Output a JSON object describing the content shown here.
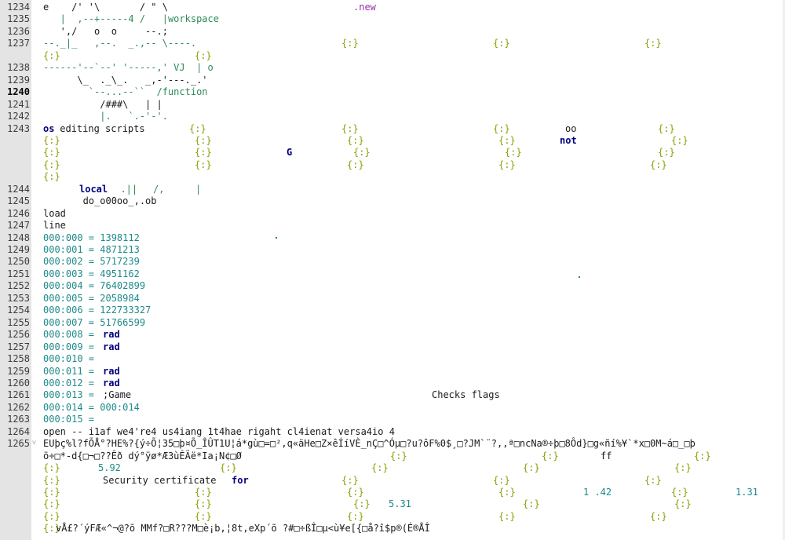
{
  "editor": {
    "current_line": 1240,
    "lines": [
      {
        "n": 1234,
        "rows": [
          [
            [
              0,
              "e    /' '\\       / \" \\",
              "d"
            ],
            [
              395,
              ".new",
              "m"
            ]
          ]
        ]
      },
      {
        "n": 1235,
        "rows": [
          [
            [
              0,
              "   |  ,--+-----4 /   |workspace",
              "g"
            ]
          ]
        ]
      },
      {
        "n": 1236,
        "rows": [
          [
            [
              0,
              "   ',/   o  o     --.;",
              "d"
            ]
          ]
        ]
      },
      {
        "n": 1237,
        "rows": [
          [
            [
              0,
              "--._|_   ,--.  _.,-- \\----.",
              "g"
            ],
            [
              380,
              "{:}",
              "y"
            ],
            [
              573,
              "{:}",
              "y"
            ],
            [
              766,
              "{:}",
              "y"
            ]
          ],
          [
            [
              0,
              "{:}",
              "y"
            ],
            [
              193,
              "{:}",
              "y"
            ]
          ]
        ]
      },
      {
        "n": 1238,
        "rows": [
          [
            [
              0,
              "------'--`--' '-----,' VJ  | o",
              "g"
            ]
          ]
        ]
      },
      {
        "n": 1239,
        "rows": [
          [
            [
              0,
              "      \\_  ._\\_.   _,-'---._.'",
              "d"
            ]
          ]
        ]
      },
      {
        "n": 1240,
        "rows": [
          [
            [
              0,
              "        `--...--``  /function",
              "g"
            ]
          ]
        ]
      },
      {
        "n": 1241,
        "rows": [
          [
            [
              0,
              "          /###\\   | |",
              "d"
            ]
          ]
        ]
      },
      {
        "n": 1242,
        "rows": [
          [
            [
              0,
              "          |.   `.-'-'.",
              "g"
            ]
          ]
        ]
      },
      {
        "n": 1243,
        "rows": [
          [
            [
              0,
              "os",
              "k"
            ],
            [
              14,
              " editing scripts",
              "d"
            ],
            [
              186,
              "{:}",
              "y"
            ],
            [
              380,
              "{:}",
              "y"
            ],
            [
              573,
              "{:}",
              "y"
            ],
            [
              665,
              "oo",
              "d"
            ],
            [
              783,
              "{:}",
              "y"
            ]
          ],
          [
            [
              0,
              "{:}",
              "y"
            ],
            [
              193,
              "{:}",
              "y"
            ],
            [
              387,
              "{:}",
              "y"
            ],
            [
              580,
              "{:}",
              "y"
            ],
            [
              658,
              "not",
              "k"
            ],
            [
              800,
              "{:}",
              "y"
            ]
          ],
          [
            [
              0,
              "{:}",
              "y"
            ],
            [
              193,
              "{:}",
              "y"
            ],
            [
              310,
              "G",
              "k"
            ],
            [
              395,
              "{:}",
              "y"
            ],
            [
              588,
              "{:}",
              "y"
            ],
            [
              783,
              "{:}",
              "y"
            ]
          ],
          [
            [
              0,
              "{:}",
              "y"
            ],
            [
              193,
              "{:}",
              "y"
            ],
            [
              387,
              "{:}",
              "y"
            ],
            [
              580,
              "{:}",
              "y"
            ],
            [
              773,
              "{:}",
              "y"
            ]
          ],
          [
            [
              0,
              "{:}",
              "y"
            ]
          ]
        ]
      },
      {
        "n": 1244,
        "rows": [
          [
            [
              0,
              "      ",
              "d"
            ],
            [
              46,
              "local",
              "k"
            ],
            [
              84,
              "  .|| ",
              "g"
            ],
            [
              140,
              "/,",
              "g"
            ],
            [
              194,
              "|",
              "g"
            ]
          ]
        ]
      },
      {
        "n": 1245,
        "rows": [
          [
            [
              0,
              "       do_o00oo_,.ob",
              "d"
            ]
          ]
        ]
      },
      {
        "n": 1246,
        "rows": [
          [
            [
              0,
              "load",
              "d"
            ]
          ]
        ]
      },
      {
        "n": 1247,
        "rows": [
          [
            [
              0,
              "line",
              "d"
            ]
          ]
        ]
      },
      {
        "n": 1248,
        "rows": [
          [
            [
              0,
              "000:000 = 1398112",
              "t"
            ]
          ]
        ]
      },
      {
        "n": 1249,
        "rows": [
          [
            [
              0,
              "000:001 = 4871213",
              "t"
            ]
          ]
        ]
      },
      {
        "n": 1250,
        "rows": [
          [
            [
              0,
              "000:002 = 5717239",
              "t"
            ]
          ]
        ]
      },
      {
        "n": 1251,
        "rows": [
          [
            [
              0,
              "000:003 = 4951162",
              "t"
            ]
          ]
        ]
      },
      {
        "n": 1252,
        "rows": [
          [
            [
              0,
              "000:004 = 76402899",
              "t"
            ]
          ]
        ]
      },
      {
        "n": 1253,
        "rows": [
          [
            [
              0,
              "000:005 = 2058984",
              "t"
            ]
          ]
        ]
      },
      {
        "n": 1254,
        "rows": [
          [
            [
              0,
              "000:006 = 122733327",
              "t"
            ]
          ]
        ]
      },
      {
        "n": 1255,
        "rows": [
          [
            [
              0,
              "000:007 = 51766599",
              "t"
            ]
          ]
        ]
      },
      {
        "n": 1256,
        "rows": [
          [
            [
              0,
              "000:008 = ",
              "t"
            ],
            [
              76,
              "rad",
              "k"
            ]
          ]
        ]
      },
      {
        "n": 1257,
        "rows": [
          [
            [
              0,
              "000:009 = ",
              "t"
            ],
            [
              76,
              "rad",
              "k"
            ]
          ]
        ]
      },
      {
        "n": 1258,
        "rows": [
          [
            [
              0,
              "000:010 =",
              "t"
            ]
          ]
        ]
      },
      {
        "n": 1259,
        "rows": [
          [
            [
              0,
              "000:011 = ",
              "t"
            ],
            [
              76,
              "rad",
              "k"
            ]
          ]
        ]
      },
      {
        "n": 1260,
        "rows": [
          [
            [
              0,
              "000:012 = ",
              "t"
            ],
            [
              76,
              "rad",
              "k"
            ]
          ]
        ]
      },
      {
        "n": 1261,
        "rows": [
          [
            [
              0,
              "000:013 = ",
              "t"
            ],
            [
              76,
              ";Game",
              "d"
            ],
            [
              495,
              "Checks flags",
              "d"
            ]
          ]
        ]
      },
      {
        "n": 1262,
        "rows": [
          [
            [
              0,
              "000:014 = 000:014",
              "t"
            ]
          ]
        ]
      },
      {
        "n": 1263,
        "rows": [
          [
            [
              0,
              "000:015 =",
              "t"
            ]
          ]
        ]
      },
      {
        "n": 1264,
        "rows": [
          [
            [
              0,
              "open -- i1af we4're4 us4iang 1t4hae rigaht cl4ienat versa4io 4",
              "d"
            ]
          ]
        ]
      },
      {
        "n": 1265,
        "fold": true,
        "rows": [
          [
            [
              0,
              "EUþç%l?fÕÅ°?HE%?{ý÷Õ¦35□þ¤Õ_ÎÛT1U¦á*gù□=□²,q«äHe□Z×êÍíVÈ_nÇ□^Óµ□?u?ôF%0$¸□?JM`¨?,,ª□ncNa®÷þ□8Ôd}□g«ñí%¥`*x□0M~á□_□þ",
              "d"
            ]
          ],
          [
            [
              0,
              "ö÷□*-d{□¬□??Êð dý°ÿø*Æ3ùÊÄë*Ia¡N¢□Ø",
              "d"
            ],
            [
              442,
              "{:}",
              "y"
            ],
            [
              635,
              "{:}",
              "y"
            ],
            [
              710,
              "ff",
              "d"
            ],
            [
              829,
              "{:}",
              "y"
            ]
          ],
          [
            [
              0,
              "{:}",
              "y"
            ],
            [
              70,
              "5.92",
              "n"
            ],
            [
              225,
              "{:}",
              "y"
            ],
            [
              418,
              "{:}",
              "y"
            ],
            [
              611,
              "{:}",
              "y"
            ],
            [
              804,
              "{:}",
              "y"
            ]
          ],
          [
            [
              0,
              "{:}",
              "y"
            ],
            [
              76,
              "Security certificate ",
              "d"
            ],
            [
              240,
              "for",
              "k"
            ],
            [
              380,
              "{:}",
              "y"
            ],
            [
              573,
              "{:}",
              "y"
            ],
            [
              766,
              "{:}",
              "y"
            ]
          ],
          [
            [
              0,
              "{:}",
              "y"
            ],
            [
              193,
              "{:}",
              "y"
            ],
            [
              387,
              "{:}",
              "y"
            ],
            [
              580,
              "{:}",
              "y"
            ],
            [
              688,
              "1 .42",
              "n"
            ],
            [
              800,
              "{:}",
              "y"
            ],
            [
              882,
              "1.31",
              "n"
            ]
          ],
          [
            [
              0,
              "{:}",
              "y"
            ],
            [
              193,
              "{:}",
              "y"
            ],
            [
              395,
              "{:}",
              "y"
            ],
            [
              440,
              "5.31",
              "n"
            ],
            [
              611,
              "{:}",
              "y"
            ],
            [
              804,
              "{:}",
              "y"
            ]
          ],
          [
            [
              0,
              "{:}",
              "y"
            ],
            [
              193,
              "{:}",
              "y"
            ],
            [
              387,
              "{:}",
              "y"
            ],
            [
              580,
              "{:}",
              "y"
            ],
            [
              773,
              "{:}",
              "y"
            ]
          ],
          [
            [
              0,
              "{:}",
              "y"
            ],
            [
              16,
              "vÅ£?´ýFÆ«^¬@?õ MMf?□R???M□è¡b,¦8t,eXp´õ ?#□÷ßÎ□µ<ù¥e[{□å?î$p®(É®ÅÎ",
              "d"
            ]
          ]
        ]
      }
    ]
  }
}
